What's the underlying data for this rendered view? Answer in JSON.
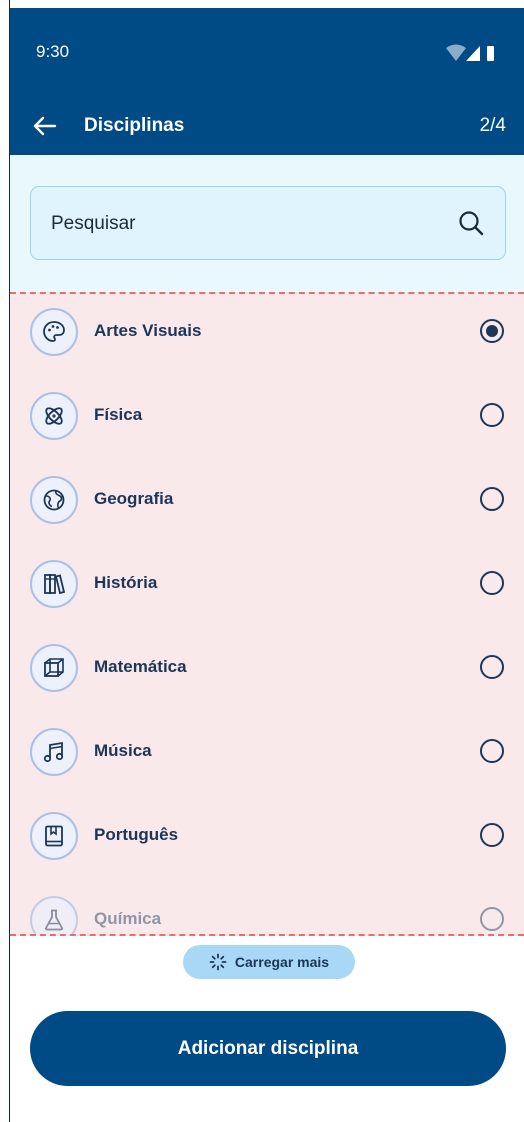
{
  "status_bar": {
    "time": "9:30",
    "icons": [
      "wifi-icon",
      "signal-icon",
      "battery-icon"
    ]
  },
  "app_bar": {
    "back_icon": "arrow-left-icon",
    "title": "Disciplinas",
    "step": "2/4"
  },
  "search": {
    "placeholder": "Pesquisar",
    "value": "",
    "icon": "search-icon"
  },
  "subjects": [
    {
      "label": "Artes Visuais",
      "icon": "palette-icon",
      "selected": true
    },
    {
      "label": "Física",
      "icon": "atom-icon",
      "selected": false
    },
    {
      "label": "Geografia",
      "icon": "globe-icon",
      "selected": false
    },
    {
      "label": "História",
      "icon": "books-icon",
      "selected": false
    },
    {
      "label": "Matemática",
      "icon": "cube-icon",
      "selected": false
    },
    {
      "label": "Música",
      "icon": "music-note-icon",
      "selected": false
    },
    {
      "label": "Português",
      "icon": "book-bookmark-icon",
      "selected": false
    },
    {
      "label": "Química",
      "icon": "flask-icon",
      "selected": false
    }
  ],
  "load_more": {
    "label": "Carregar mais",
    "icon": "spinner-icon"
  },
  "primary_action": {
    "label": "Adicionar disciplina"
  },
  "colors": {
    "primary": "#004a85",
    "text": "#1d3557",
    "list_background": "#f9e9eb",
    "accent_dashed": "#ef6b6b",
    "chip": "#a8d8f6"
  }
}
